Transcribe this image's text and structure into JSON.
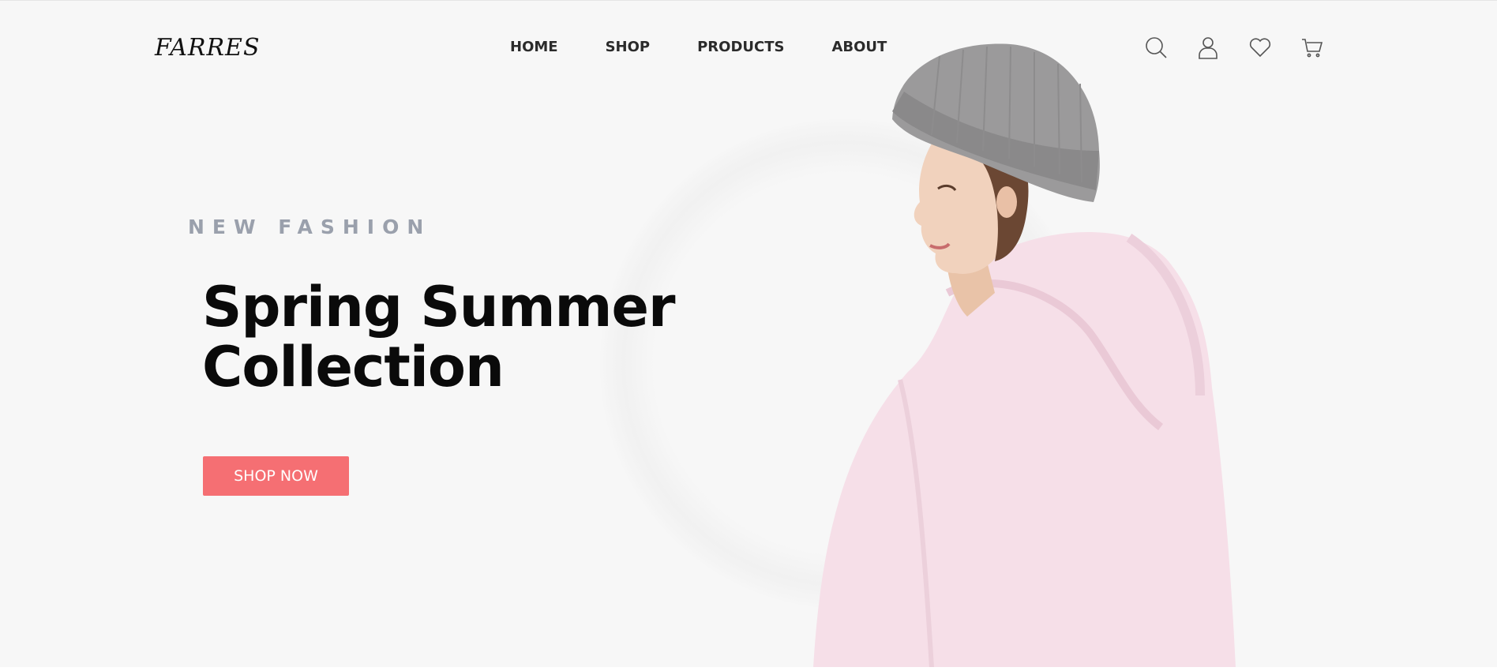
{
  "header": {
    "logo": "FARRES",
    "nav": [
      "HOME",
      "SHOP",
      "PRODUCTS",
      "ABOUT"
    ],
    "icons": [
      "search-icon",
      "user-icon",
      "heart-icon",
      "cart-icon"
    ]
  },
  "hero": {
    "eyebrow": "NEW FASHION",
    "headline_line1": "Spring Summer",
    "headline_line2": "Collection",
    "cta_label": "SHOP NOW",
    "cta_color": "#f56f73",
    "image": "model-in-pink-hoodie-and-grey-beanie"
  },
  "colors": {
    "background": "#f7f7f7",
    "eyebrow": "#9aa0ac",
    "headline": "#0a0a0a"
  }
}
